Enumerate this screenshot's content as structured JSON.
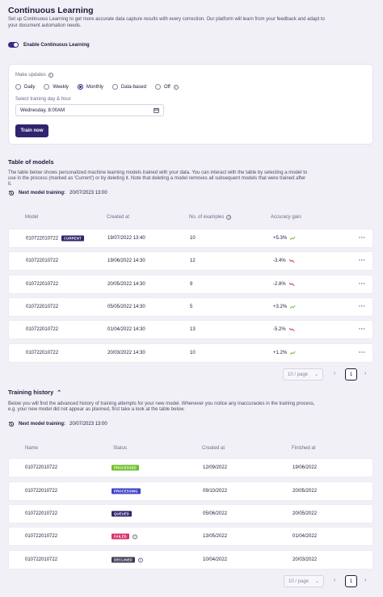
{
  "header": {
    "title": "Continuous Learning",
    "description": "Set up Continuous Learning to get more accurate data capture results with every correction. Our platform will learn from your feedback and adapt to your document automation needs."
  },
  "toggle": {
    "label": "Enable Continuous Learning",
    "enabled": true
  },
  "settings": {
    "updates_label": "Make updates",
    "options": [
      "Daily",
      "Weekly",
      "Monthly",
      "Data-based",
      "Off"
    ],
    "selected": "Monthly",
    "training_label": "Select training day & hour",
    "training_value": "Wednesday, 8:00AM",
    "train_button": "Train now"
  },
  "models": {
    "title": "Table of models",
    "description": "The table below shows personalized machine learning models trained with your data. You can interact with the table by selecting a model to use in the process (marked as 'Current') or by deleting it. Note that deleting a model removes all subsequent models that were trained after it.",
    "next_label": "Next model training:",
    "next_date": "20/07/2023 13:00",
    "headers": [
      "Model",
      "Created at",
      "No. of examples",
      "Accuracy gain"
    ],
    "rows": [
      {
        "model": "010722010722",
        "badge": "CURRENT",
        "created": "19/07/2022 13:40",
        "examples": "10",
        "gain": "+5.3%",
        "trend": "up"
      },
      {
        "model": "010722010722",
        "badge": "",
        "created": "19/06/2022 14:30",
        "examples": "12",
        "gain": "-3.4%",
        "trend": "down"
      },
      {
        "model": "010722010722",
        "badge": "",
        "created": "20/05/2022 14:30",
        "examples": "9",
        "gain": "-2.8%",
        "trend": "down"
      },
      {
        "model": "010722010722",
        "badge": "",
        "created": "05/05/2022 14:30",
        "examples": "5",
        "gain": "+3.2%",
        "trend": "up"
      },
      {
        "model": "010722010722",
        "badge": "",
        "created": "01/04/2022 14:30",
        "examples": "13",
        "gain": "-5.2%",
        "trend": "down"
      },
      {
        "model": "010722010722",
        "badge": "",
        "created": "20/03/2022 14:30",
        "examples": "10",
        "gain": "+1.2%",
        "trend": "up"
      }
    ],
    "page_size": "10 / page",
    "page": "1"
  },
  "history": {
    "title": "Training history",
    "description": "Below you will find the advanced history of training attempts for your new model. Whenever you notice any inaccuracies in the training process, e.g. your new model did not appear as planned, first take a look at the table below.",
    "next_label": "Next model training:",
    "next_date": "20/07/2023 13:00",
    "headers": [
      "Name",
      "Status",
      "Created at",
      "Finished at"
    ],
    "rows": [
      {
        "name": "010722010722",
        "status": "PROCESSED",
        "color": "#6fbf2a",
        "info": false,
        "created": "12/09/2022",
        "finished": "19/06/2022"
      },
      {
        "name": "010722010722",
        "status": "PROCESSING",
        "color": "#3f3fc8",
        "info": false,
        "created": "09/10/2022",
        "finished": "20/05/2022"
      },
      {
        "name": "010722010722",
        "status": "QUEUED",
        "color": "#2e2470",
        "info": false,
        "created": "05/06/2022",
        "finished": "20/05/2022"
      },
      {
        "name": "010722010722",
        "status": "FAILED",
        "color": "#d6336c",
        "info": true,
        "created": "13/05/2022",
        "finished": "01/04/2022"
      },
      {
        "name": "010722010722",
        "status": "DECLINED",
        "color": "#3d3d55",
        "info": true,
        "created": "10/04/2022",
        "finished": "20/03/2022"
      }
    ],
    "page_size": "10 / page",
    "page": "1"
  },
  "colors": {
    "accent": "#2e2470",
    "current_badge": "#2e2470",
    "up": "#6fbf2a",
    "down": "#d6336c"
  }
}
